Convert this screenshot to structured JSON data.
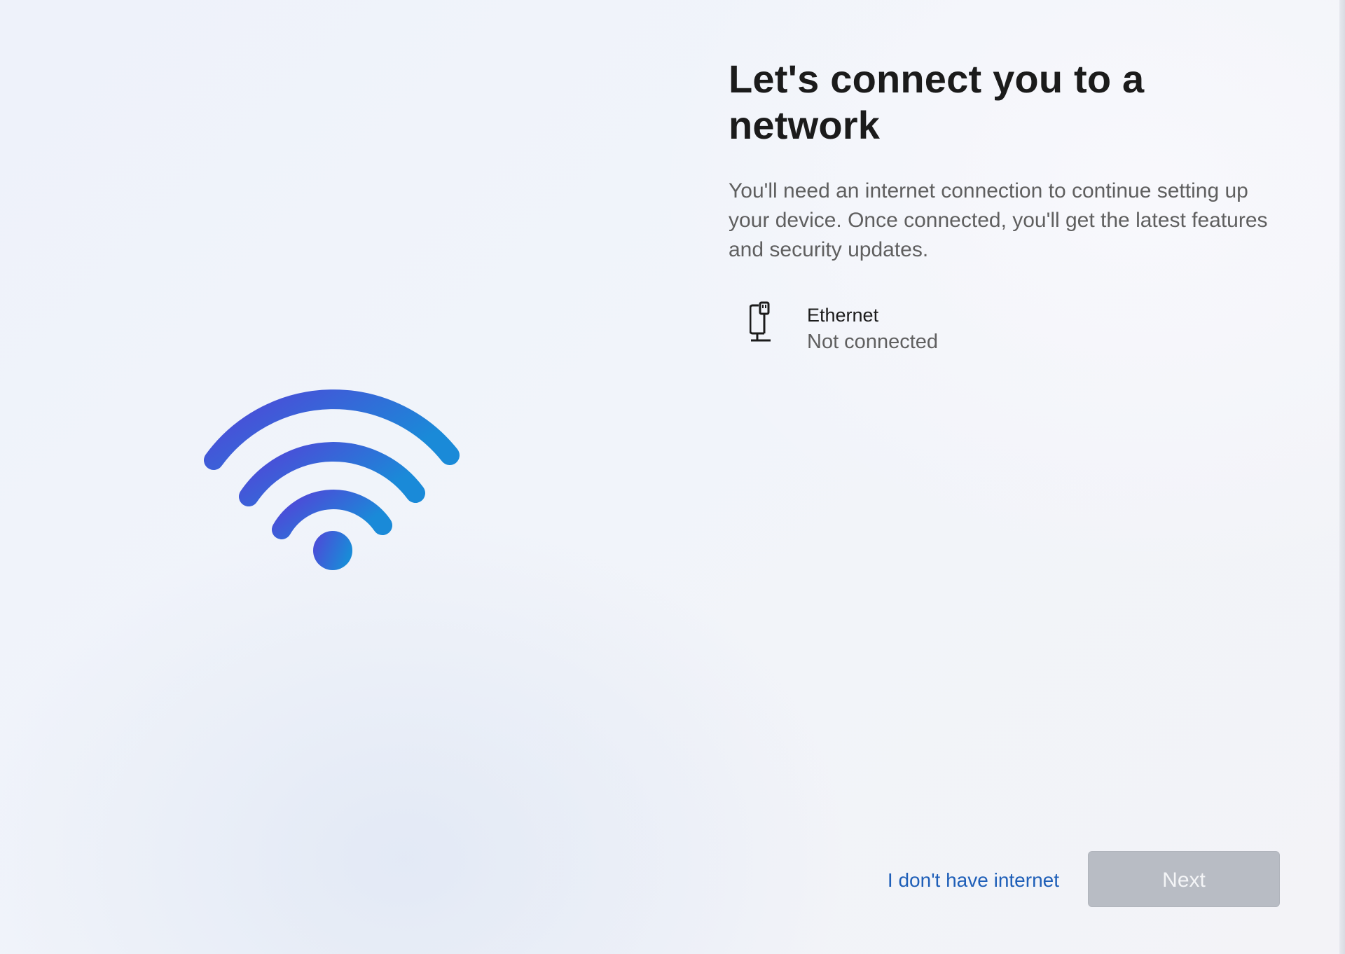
{
  "page": {
    "title": "Let's connect you to a network",
    "description": "You'll need an internet connection to continue setting up your device. Once connected, you'll get the latest features and security updates."
  },
  "illustration": {
    "icon": "wifi-icon",
    "gradient_start": "#5047d8",
    "gradient_end": "#1a86d6"
  },
  "networks": [
    {
      "icon": "ethernet-monitor-icon",
      "name": "Ethernet",
      "status": "Not connected"
    }
  ],
  "actions": {
    "no_internet_label": "I don't have internet",
    "next_label": "Next",
    "next_enabled": false,
    "link_color": "#1f5fb8"
  }
}
